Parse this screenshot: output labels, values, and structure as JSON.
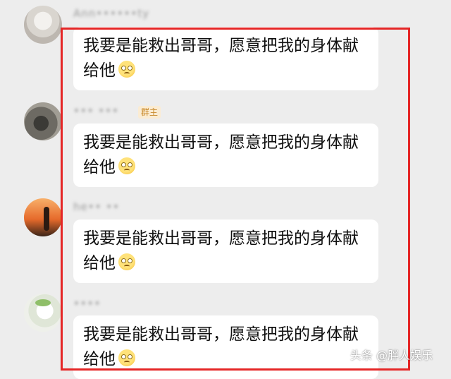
{
  "messages": [
    {
      "name": "Ann••••••ty",
      "badge": "",
      "text": "我要是能救出哥哥，愿意把我的身体献给他"
    },
    {
      "name": "••• •••",
      "badge": "群主",
      "text": "我要是能救出哥哥，愿意把我的身体献给他"
    },
    {
      "name": "he•• ••",
      "badge": "",
      "text": "我要是能救出哥哥，愿意把我的身体献给他"
    },
    {
      "name": "••••",
      "badge": "",
      "text": "我要是能救出哥哥，愿意把我的身体献给他"
    }
  ],
  "emoji": "slightly-frowning-face-icon",
  "highlight_color": "#e52626",
  "watermark": "头条 @胖人娱乐"
}
